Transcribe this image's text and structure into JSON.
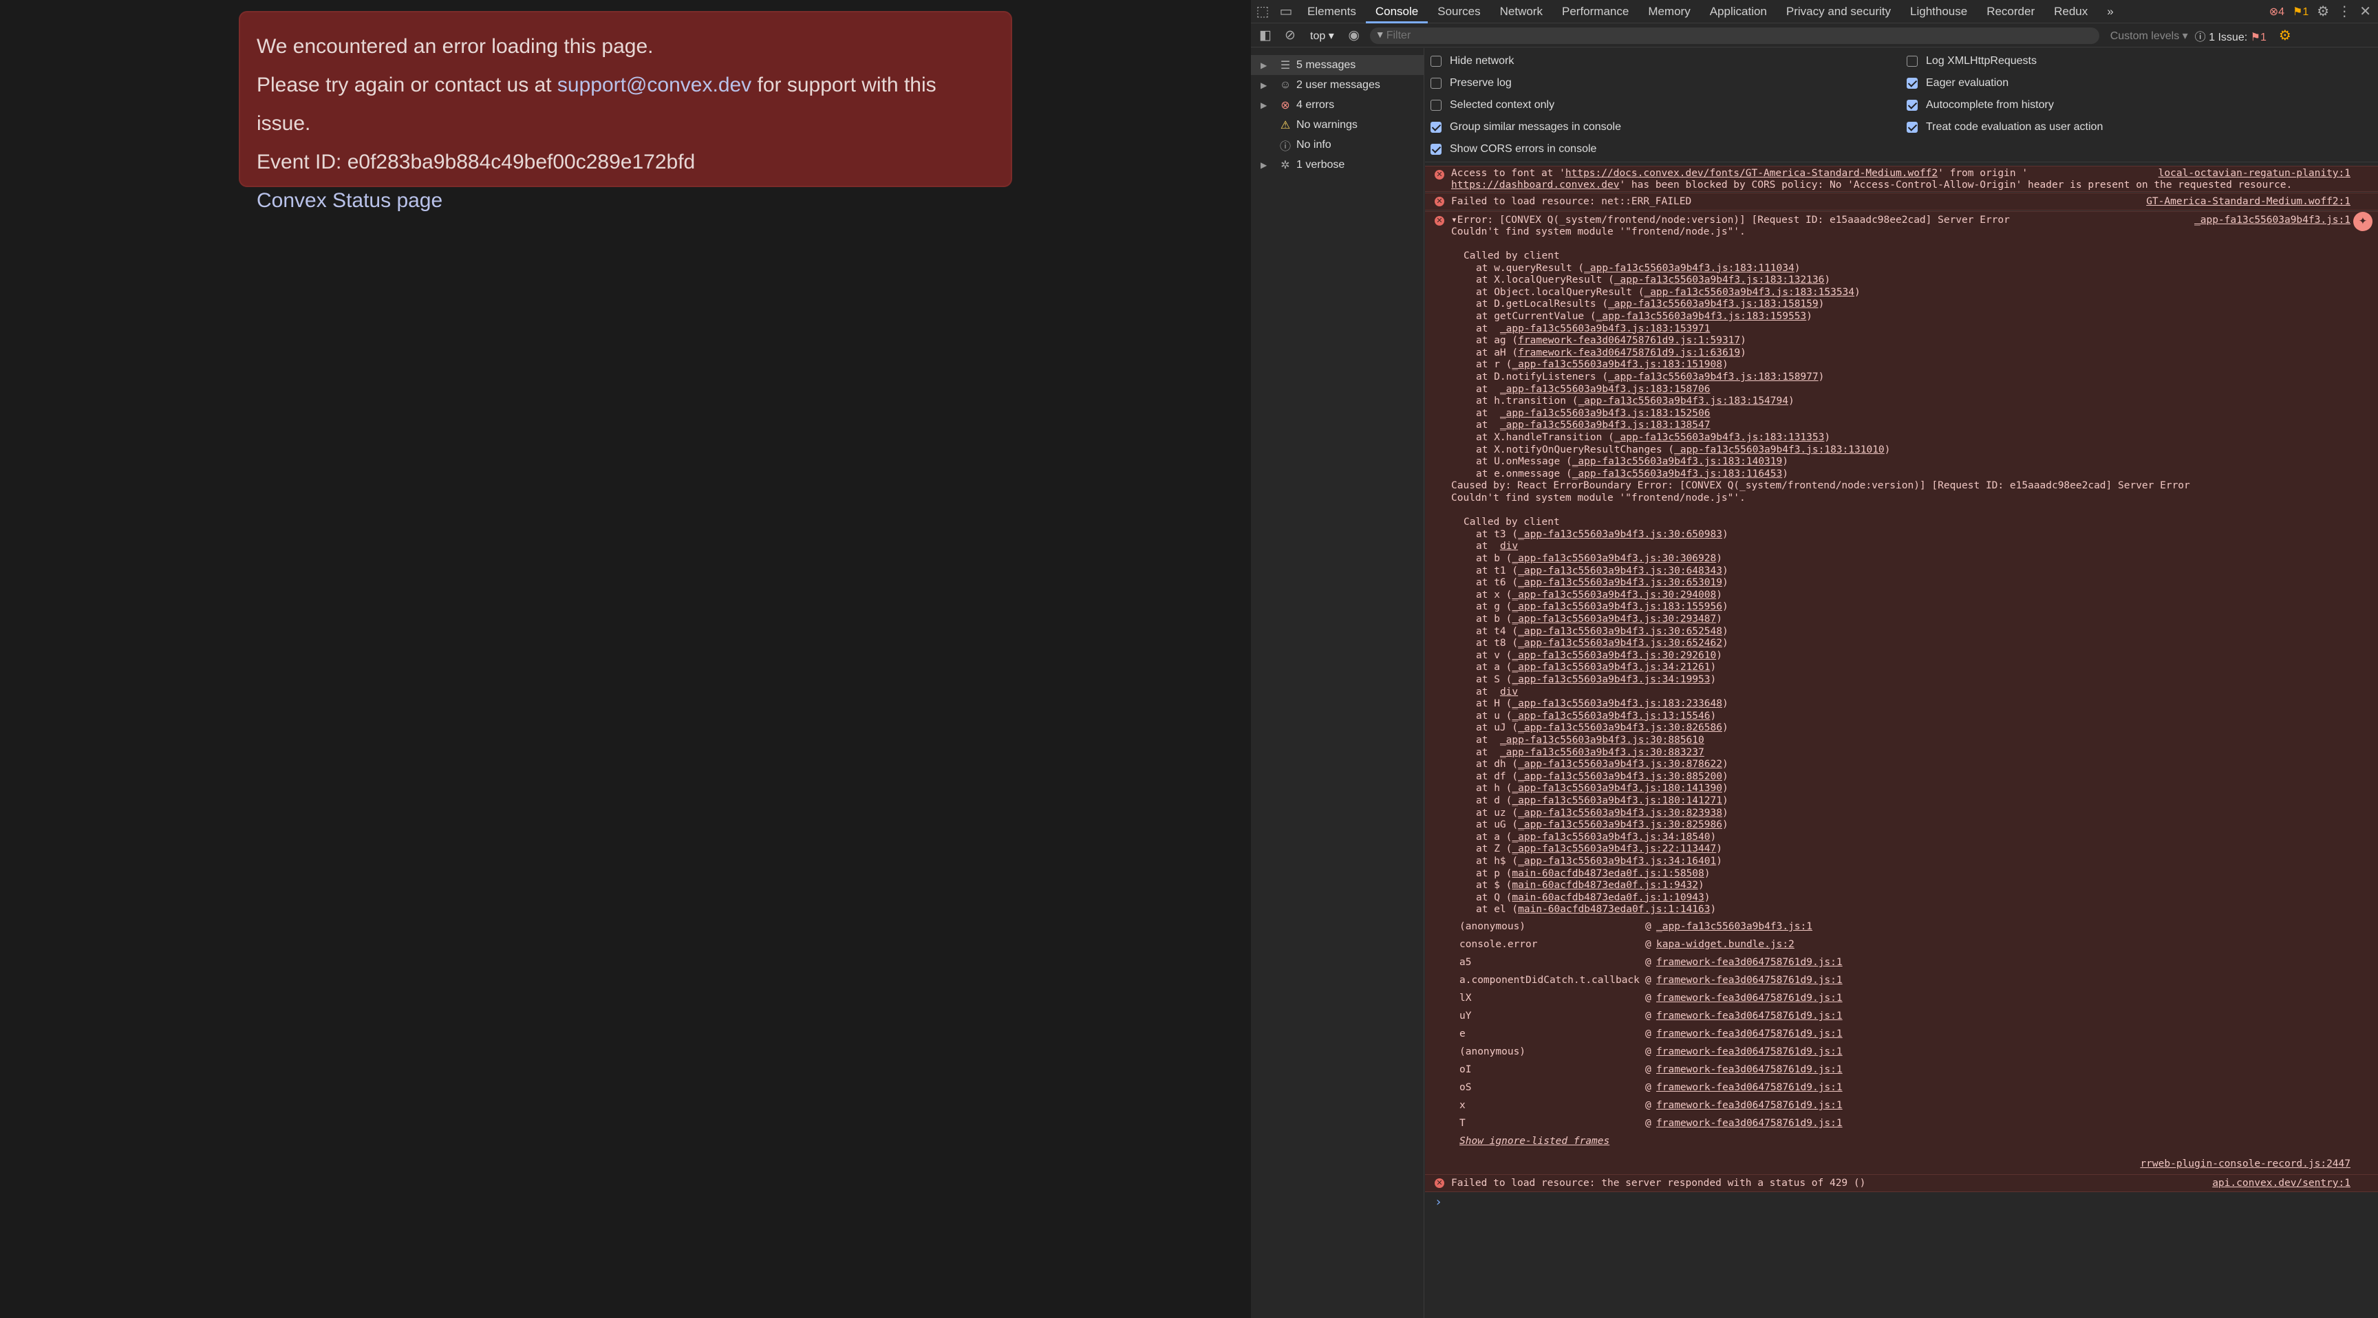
{
  "page": {
    "error_card": {
      "line1": "We encountered an error loading this page.",
      "line2_prefix": "Please try again or contact us at ",
      "support_email": "support@convex.dev",
      "line2_suffix": " for support with this issue.",
      "event_id": "Event ID: e0f283ba9b884c49bef00c289e172bfd",
      "status_link": "Convex Status page"
    }
  },
  "devtools": {
    "tabs": [
      "Elements",
      "Console",
      "Sources",
      "Network",
      "Performance",
      "Memory",
      "Application",
      "Privacy and security",
      "Lighthouse",
      "Recorder",
      "Redux"
    ],
    "active_tab": "Console",
    "more_tabs": "»",
    "error_count": "4",
    "warning_count": "1",
    "toolbar": {
      "context": "top ▾",
      "filter_placeholder": "Filter",
      "levels": "Custom levels ▾",
      "issues_label": "1 Issue:",
      "issues_count": "1"
    },
    "sidebar": [
      {
        "label": "5 messages",
        "icon": "list-icon"
      },
      {
        "label": "2 user messages",
        "icon": "user-icon"
      },
      {
        "label": "4 errors",
        "icon": "error-icon"
      },
      {
        "label": "No warnings",
        "icon": "warning-icon"
      },
      {
        "label": "No info",
        "icon": "info-icon"
      },
      {
        "label": "1 verbose",
        "icon": "bug-icon"
      }
    ],
    "settings_left": [
      {
        "label": "Hide network",
        "checked": false
      },
      {
        "label": "Preserve log",
        "checked": false
      },
      {
        "label": "Selected context only",
        "checked": false
      },
      {
        "label": "Group similar messages in console",
        "checked": true
      },
      {
        "label": "Show CORS errors in console",
        "checked": true
      }
    ],
    "settings_right": [
      {
        "label": "Log XMLHttpRequests",
        "checked": false
      },
      {
        "label": "Eager evaluation",
        "checked": true
      },
      {
        "label": "Autocomplete from history",
        "checked": true
      },
      {
        "label": "Treat code evaluation as user action",
        "checked": true
      }
    ],
    "console": {
      "msg1_line1_a": "Access to font at '",
      "msg1_url": "https://docs.convex.dev/fonts/GT-America-Standard-Medium.woff2",
      "msg1_line1_b": "' from origin '",
      "msg1_line2_origin": "https://dashboard.convex.dev",
      "msg1_line2_b": "' has been blocked by CORS policy: No 'Access-Control-Allow-Origin' header is present on the requested resource.",
      "msg1_src": "local-octavian-regatun-planity:1",
      "msg2_text": "Failed to load resource: net::ERR_FAILED",
      "msg2_src": "GT-America-Standard-Medium.woff2:1",
      "msg3_head": "▾Error: [CONVEX Q(_system/frontend/node:version)] [Request ID: e15aaadc98ee2cad] Server Error",
      "msg3_sub": "Couldn't find system module '\"frontend/node.js\"'.",
      "msg3_src": "_app-fa13c55603a9b4f3.js:1",
      "called_by": "Called by client",
      "trace1": [
        [
          "w.queryResult",
          "_app-fa13c55603a9b4f3.js:183:111034"
        ],
        [
          "X.localQueryResult",
          "_app-fa13c55603a9b4f3.js:183:132136"
        ],
        [
          "Object.localQueryResult",
          "_app-fa13c55603a9b4f3.js:183:153534"
        ],
        [
          "D.getLocalResults",
          "_app-fa13c55603a9b4f3.js:183:158159"
        ],
        [
          "getCurrentValue",
          "_app-fa13c55603a9b4f3.js:183:159553"
        ],
        [
          "",
          "_app-fa13c55603a9b4f3.js:183:153971"
        ],
        [
          "ag",
          "framework-fea3d064758761d9.js:1:59317"
        ],
        [
          "aH",
          "framework-fea3d064758761d9.js:1:63619"
        ],
        [
          "r",
          "_app-fa13c55603a9b4f3.js:183:151908"
        ],
        [
          "D.notifyListeners",
          "_app-fa13c55603a9b4f3.js:183:158977"
        ],
        [
          "",
          "_app-fa13c55603a9b4f3.js:183:158706"
        ],
        [
          "h.transition",
          "_app-fa13c55603a9b4f3.js:183:154794"
        ],
        [
          "",
          "_app-fa13c55603a9b4f3.js:183:152506"
        ],
        [
          "",
          "_app-fa13c55603a9b4f3.js:183:138547"
        ],
        [
          "X.handleTransition",
          "_app-fa13c55603a9b4f3.js:183:131353"
        ],
        [
          "X.notifyOnQueryResultChanges",
          "_app-fa13c55603a9b4f3.js:183:131010"
        ],
        [
          "U.onMessage",
          "_app-fa13c55603a9b4f3.js:183:140319"
        ],
        [
          "e.onmessage",
          "_app-fa13c55603a9b4f3.js:183:116453"
        ]
      ],
      "caused_by": "Caused by: React ErrorBoundary Error: [CONVEX Q(_system/frontend/node:version)] [Request ID: e15aaadc98ee2cad] Server Error",
      "caused_sub": "Couldn't find system module '\"frontend/node.js\"'.",
      "trace2": [
        [
          "t3",
          "_app-fa13c55603a9b4f3.js:30:650983"
        ],
        [
          "",
          "div"
        ],
        [
          "b",
          "_app-fa13c55603a9b4f3.js:30:306928"
        ],
        [
          "t1",
          "_app-fa13c55603a9b4f3.js:30:648343"
        ],
        [
          "t6",
          "_app-fa13c55603a9b4f3.js:30:653019"
        ],
        [
          "x",
          "_app-fa13c55603a9b4f3.js:30:294008"
        ],
        [
          "g",
          "_app-fa13c55603a9b4f3.js:183:155956"
        ],
        [
          "b",
          "_app-fa13c55603a9b4f3.js:30:293487"
        ],
        [
          "t4",
          "_app-fa13c55603a9b4f3.js:30:652548"
        ],
        [
          "t8",
          "_app-fa13c55603a9b4f3.js:30:652462"
        ],
        [
          "v",
          "_app-fa13c55603a9b4f3.js:30:292610"
        ],
        [
          "a",
          "_app-fa13c55603a9b4f3.js:34:21261"
        ],
        [
          "S",
          "_app-fa13c55603a9b4f3.js:34:19953"
        ],
        [
          "",
          "div"
        ],
        [
          "H",
          "_app-fa13c55603a9b4f3.js:183:233648"
        ],
        [
          "u",
          "_app-fa13c55603a9b4f3.js:13:15546"
        ],
        [
          "uJ",
          "_app-fa13c55603a9b4f3.js:30:826586"
        ],
        [
          "",
          "_app-fa13c55603a9b4f3.js:30:885610"
        ],
        [
          "",
          "_app-fa13c55603a9b4f3.js:30:883237"
        ],
        [
          "dh",
          "_app-fa13c55603a9b4f3.js:30:878622"
        ],
        [
          "df",
          "_app-fa13c55603a9b4f3.js:30:885200"
        ],
        [
          "h",
          "_app-fa13c55603a9b4f3.js:180:141390"
        ],
        [
          "d",
          "_app-fa13c55603a9b4f3.js:180:141271"
        ],
        [
          "uz",
          "_app-fa13c55603a9b4f3.js:30:823938"
        ],
        [
          "uG",
          "_app-fa13c55603a9b4f3.js:30:825986"
        ],
        [
          "a",
          "_app-fa13c55603a9b4f3.js:34:18540"
        ],
        [
          "Z",
          "_app-fa13c55603a9b4f3.js:22:113447"
        ],
        [
          "h$",
          "_app-fa13c55603a9b4f3.js:34:16401"
        ],
        [
          "p",
          "main-60acfdb4873eda0f.js:1:58508"
        ],
        [
          "$",
          "main-60acfdb4873eda0f.js:1:9432"
        ],
        [
          "Q",
          "main-60acfdb4873eda0f.js:1:10943"
        ],
        [
          "el",
          "main-60acfdb4873eda0f.js:1:14163"
        ]
      ],
      "frames": [
        [
          "(anonymous)",
          "_app-fa13c55603a9b4f3.js:1"
        ],
        [
          "console.error",
          "kapa-widget.bundle.js:2"
        ],
        [
          "a5",
          "framework-fea3d064758761d9.js:1"
        ],
        [
          "a.componentDidCatch.t.callback",
          "framework-fea3d064758761d9.js:1"
        ],
        [
          "lX",
          "framework-fea3d064758761d9.js:1"
        ],
        [
          "uY",
          "framework-fea3d064758761d9.js:1"
        ],
        [
          "e",
          "framework-fea3d064758761d9.js:1"
        ],
        [
          "(anonymous)",
          "framework-fea3d064758761d9.js:1"
        ],
        [
          "oI",
          "framework-fea3d064758761d9.js:1"
        ],
        [
          "oS",
          "framework-fea3d064758761d9.js:1"
        ],
        [
          "x",
          "framework-fea3d064758761d9.js:1"
        ],
        [
          "T",
          "framework-fea3d064758761d9.js:1"
        ]
      ],
      "show_ignore": "Show ignore-listed frames",
      "rrweb_src": "rrweb-plugin-console-record.js:2447",
      "msg4_text": "Failed to load resource: the server responded with a status of 429 ()",
      "msg4_src": "api.convex.dev/sentry:1",
      "prompt": "›"
    }
  }
}
